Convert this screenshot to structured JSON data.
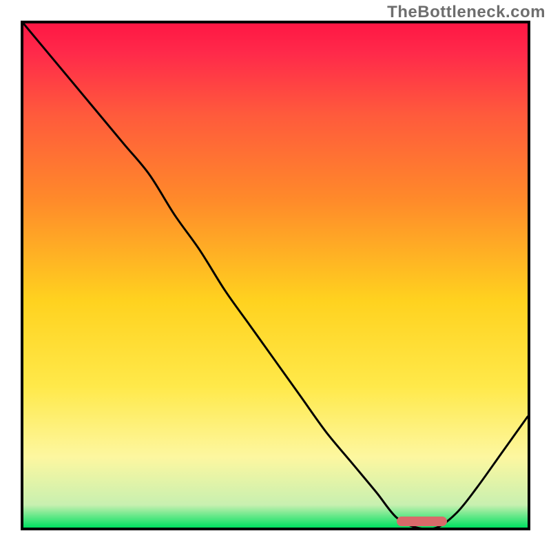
{
  "watermark": "TheBottleneck.com",
  "chart_data": {
    "type": "line",
    "title": "",
    "xlabel": "",
    "ylabel": "",
    "xlim": [
      0,
      100
    ],
    "ylim": [
      0,
      100
    ],
    "x": [
      0,
      5,
      10,
      15,
      20,
      25,
      30,
      35,
      40,
      45,
      50,
      55,
      60,
      65,
      70,
      74,
      78,
      82,
      86,
      90,
      95,
      100
    ],
    "values": [
      100,
      94,
      88,
      82,
      76,
      70,
      62,
      55,
      47,
      40,
      33,
      26,
      19,
      13,
      7,
      2,
      0,
      0,
      3,
      8,
      15,
      22
    ],
    "optimal_range_x": [
      74,
      84
    ],
    "gradient_stops": [
      {
        "offset": 0.0,
        "color": "#ff1744"
      },
      {
        "offset": 0.06,
        "color": "#ff2a4a"
      },
      {
        "offset": 0.18,
        "color": "#ff5a3c"
      },
      {
        "offset": 0.35,
        "color": "#ff8a2a"
      },
      {
        "offset": 0.55,
        "color": "#ffd21f"
      },
      {
        "offset": 0.72,
        "color": "#ffe94a"
      },
      {
        "offset": 0.86,
        "color": "#fdf7a0"
      },
      {
        "offset": 0.955,
        "color": "#c8f0b0"
      },
      {
        "offset": 1.0,
        "color": "#00e060"
      }
    ]
  }
}
